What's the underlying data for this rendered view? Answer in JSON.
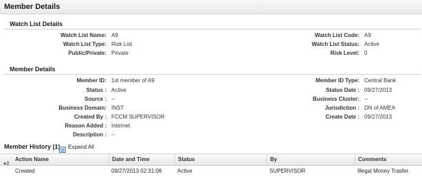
{
  "page": {
    "title": "Member Details"
  },
  "watch_list": {
    "section_title": "Watch List Details",
    "left": [
      {
        "label": "Watch List Name:",
        "value": "A9"
      },
      {
        "label": "Watch List Type:",
        "value": "Risk List"
      },
      {
        "label": "Public/Private:",
        "value": "Private"
      }
    ],
    "right": [
      {
        "label": "Watch List Code:",
        "value": "A9"
      },
      {
        "label": "Watch List Status:",
        "value": "Active"
      },
      {
        "label": "Risk Level:",
        "value": "0"
      }
    ]
  },
  "member": {
    "section_title": "Member Details",
    "left": [
      {
        "label": "Member ID:",
        "value": "1st member of A9"
      },
      {
        "label": "Status :",
        "value": "Active"
      },
      {
        "label": "Source :",
        "value": "--"
      },
      {
        "label": "Business Domain:",
        "value": "INST"
      },
      {
        "label": "Created By :",
        "value": "FCCM SUPERVISOR"
      },
      {
        "label": "Reason Added :",
        "value": "Internet"
      },
      {
        "label": "Description :",
        "value": "--"
      }
    ],
    "right": [
      {
        "label": "Member ID Type:",
        "value": "Central Bank"
      },
      {
        "label": "Status Date :",
        "value": "09/27/2013"
      },
      {
        "label": "Business Cluster:",
        "value": "--"
      },
      {
        "label": "Jurisdiction :",
        "value": "DN of AMEA"
      },
      {
        "label": "Create Date :",
        "value": "09/27/2013"
      }
    ]
  },
  "history": {
    "title": "Member History",
    "count": "(1)",
    "separator": "|",
    "expand_all": "Expand All",
    "columns": [
      "Action Name",
      "Date and Time",
      "Status",
      "By",
      "Comments"
    ],
    "rows": [
      [
        "Created",
        "09/27/2013 02:31:06",
        "Active",
        "SUPERVISOR",
        "Illegal Money Trasfer."
      ]
    ]
  }
}
